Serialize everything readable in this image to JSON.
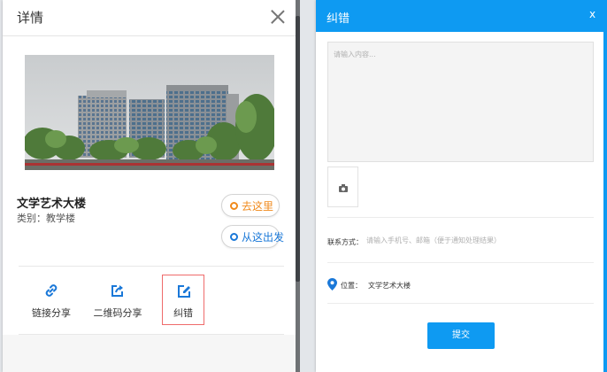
{
  "detail_panel": {
    "title": "详情",
    "place": {
      "name": "文学艺术大楼",
      "category_label": "类别：",
      "category_value": "教学楼"
    },
    "buttons": {
      "go_here": "去这里",
      "start_from_here": "从这出发"
    },
    "actions": [
      {
        "label": "链接分享",
        "icon": "link-icon"
      },
      {
        "label": "二维码分享",
        "icon": "share-icon"
      },
      {
        "label": "纠错",
        "icon": "edit-icon"
      }
    ]
  },
  "correction_dialog": {
    "title": "纠错",
    "close_label": "x",
    "content_placeholder": "请输入内容...",
    "contact_label": "联系方式：",
    "contact_placeholder": "请输入手机号、邮箱（便于通知处理结果）",
    "location_label": "位置：",
    "location_value": "文学艺术大楼",
    "submit_label": "提交"
  },
  "colors": {
    "accent_blue": "#0e9af2",
    "go_orange": "#f08a1c",
    "from_blue": "#1a78d8",
    "highlight_red": "#ef6b6b"
  }
}
